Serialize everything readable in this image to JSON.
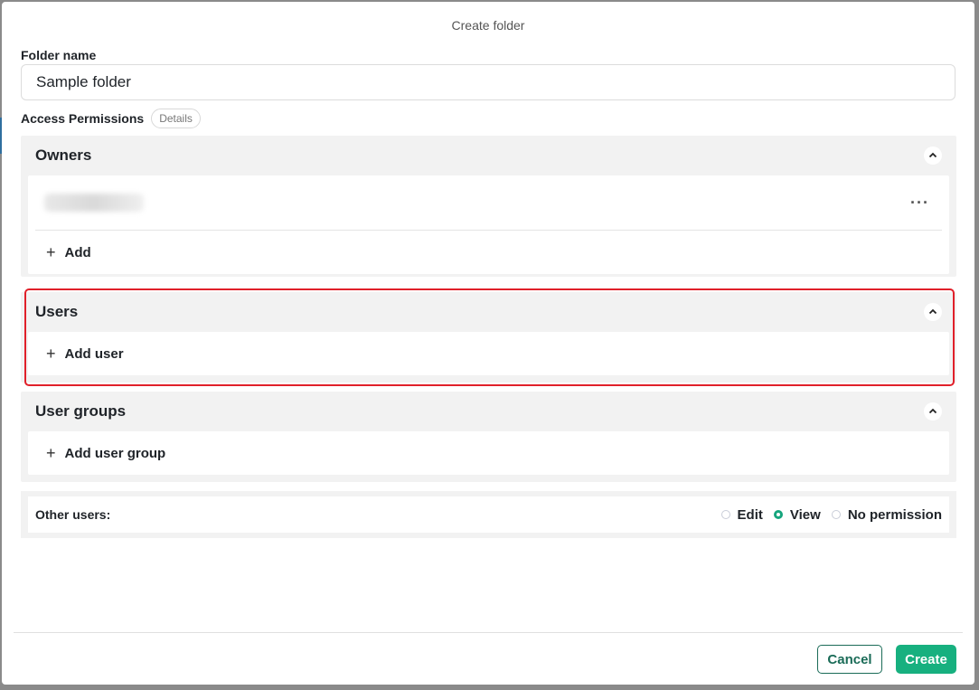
{
  "modal": {
    "title": "Create folder"
  },
  "folder": {
    "label": "Folder name",
    "value": "Sample folder"
  },
  "access": {
    "label": "Access Permissions",
    "details_label": "Details"
  },
  "sections": {
    "owners": {
      "title": "Owners",
      "add_label": "Add"
    },
    "users": {
      "title": "Users",
      "add_label": "Add user"
    },
    "user_groups": {
      "title": "User groups",
      "add_label": "Add user group"
    }
  },
  "other_users": {
    "label": "Other users:",
    "options": [
      {
        "label": "Edit",
        "checked": false
      },
      {
        "label": "View",
        "checked": true
      },
      {
        "label": "No permission",
        "checked": false
      }
    ]
  },
  "footer": {
    "cancel_label": "Cancel",
    "create_label": "Create"
  },
  "colors": {
    "accent": "#17b07f",
    "highlight": "#e0202a",
    "cancel_text": "#1a6b57"
  },
  "icons": {
    "collapse": "chevron-up-icon",
    "add": "plus-icon",
    "more": "ellipsis-icon"
  }
}
